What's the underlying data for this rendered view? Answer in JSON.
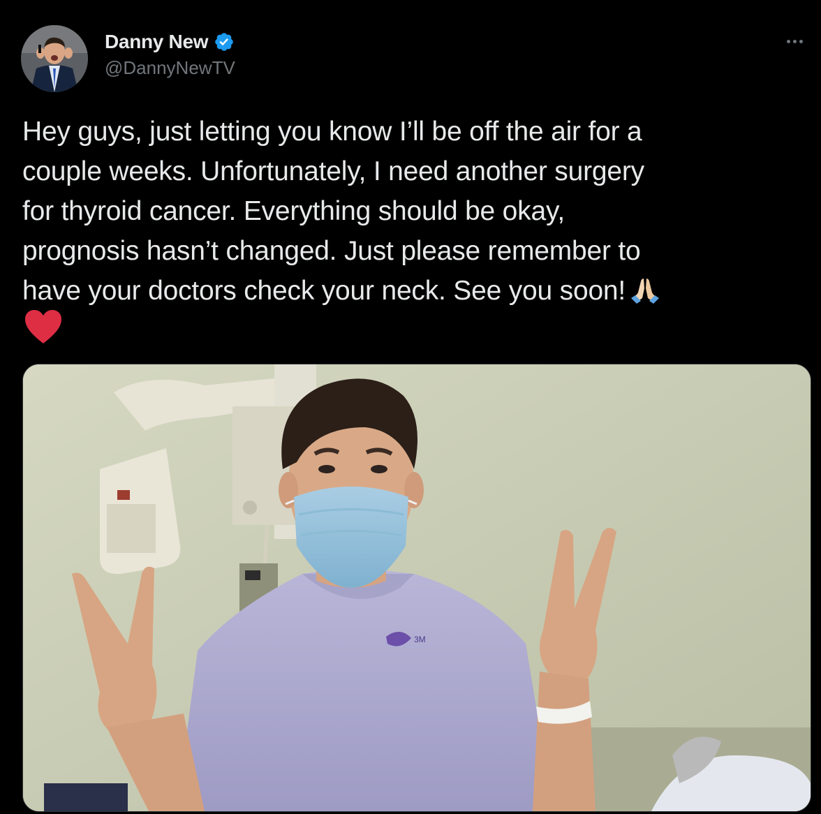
{
  "user": {
    "display_name": "Danny New",
    "handle": "@DannyNewTV",
    "verified": true
  },
  "tweet": {
    "text": "Hey guys, just letting you know I’ll be off the air for a\ncouple weeks. Unfortunately, I need another surgery\nfor thyroid cancer. Everything should be okay,\nprognosis hasn’t changed. Just please remember to\nhave your doctors check your neck. See you soon!",
    "emojis": [
      "folded-hands-icon",
      "red-heart-icon"
    ]
  },
  "media": {
    "badge_text": "3M"
  },
  "colors": {
    "background": "#000000",
    "text_primary": "#e7e9ea",
    "text_secondary": "#71767b",
    "verified_blue": "#1d9bf0",
    "heart_red": "#dd2e44"
  }
}
